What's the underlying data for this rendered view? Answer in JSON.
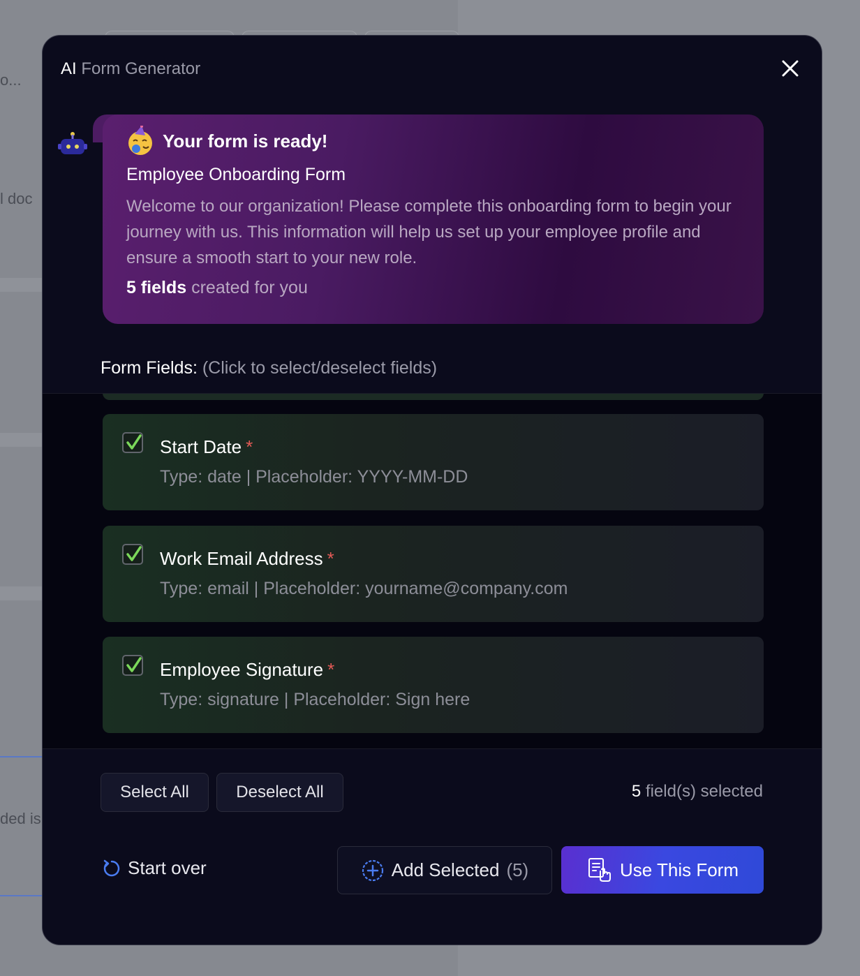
{
  "background": {
    "fragments": [
      "o...",
      "l doc",
      "ded is"
    ]
  },
  "modal": {
    "title_ai": "AI",
    "title_rest": " Form Generator"
  },
  "bubble": {
    "ready_text": "Your form is ready!",
    "form_title": "Employee Onboarding Form",
    "description": "Welcome to our organization! Please complete this onboarding form to begin your journey with us. This information will help us set up your employee profile and ensure a smooth start to your new role.",
    "fields_count": "5 fields",
    "fields_suffix": " created for you"
  },
  "fields_section": {
    "heading": "Form Fields:",
    "hint": " (Click to select/deselect fields)",
    "items": [
      {
        "name": "Start Date",
        "required_mark": "*",
        "meta": "Type: date | Placeholder: YYYY-MM-DD",
        "checked": true
      },
      {
        "name": "Work Email Address",
        "required_mark": "*",
        "meta": "Type: email | Placeholder: yourname@company.com",
        "checked": true
      },
      {
        "name": "Employee Signature",
        "required_mark": "*",
        "meta": "Type: signature | Placeholder: Sign here",
        "checked": true
      }
    ]
  },
  "footer": {
    "select_all": "Select All",
    "deselect_all": "Deselect All",
    "selected_num": "5",
    "selected_suffix": " field(s) selected",
    "start_over": "Start over",
    "add_selected": "Add Selected",
    "add_selected_count": "(5)",
    "use_form": "Use This Form"
  },
  "colors": {
    "accent_green": "#7bd85a",
    "required_red": "#e35a56",
    "primary_blue": "#3a48e0"
  },
  "icons": [
    "close-icon",
    "robot-icon",
    "party-face-icon",
    "checkmark-icon",
    "restart-icon",
    "add-circle-icon",
    "form-click-icon"
  ]
}
